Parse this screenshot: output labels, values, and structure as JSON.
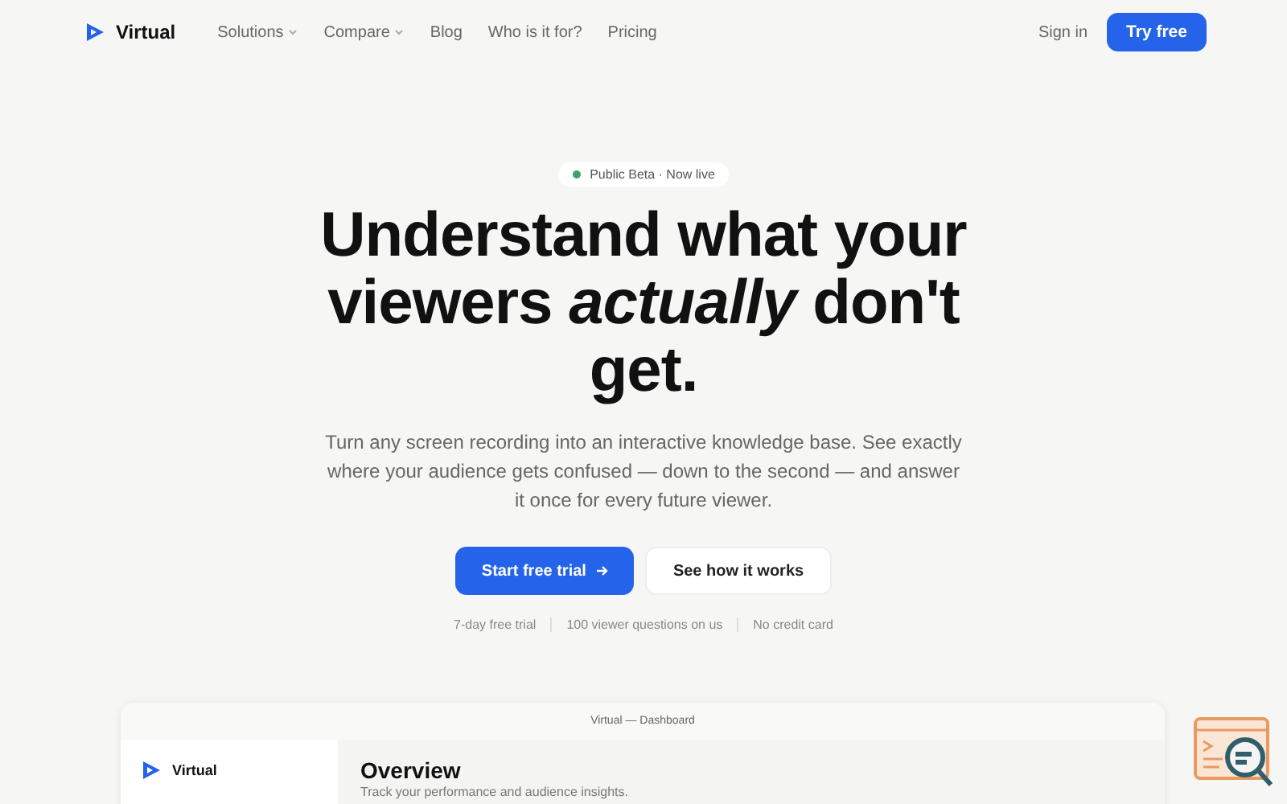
{
  "nav": {
    "brand": "Virtual",
    "links": [
      {
        "label": "Solutions",
        "dropdown": true
      },
      {
        "label": "Compare",
        "dropdown": true
      },
      {
        "label": "Blog",
        "dropdown": false
      },
      {
        "label": "Who is it for?",
        "dropdown": false
      },
      {
        "label": "Pricing",
        "dropdown": false
      }
    ],
    "sign_in": "Sign in",
    "cta": "Try free"
  },
  "hero": {
    "badge": "Public Beta · Now live",
    "headline": "Understand what your viewers *actually* don't get.",
    "subtitle": "Turn any screen recording into an interactive knowledge base. See exactly where your audience gets confused — down to the second — and answer it once for every future viewer.",
    "primary": "Start free trial",
    "secondary": "See how it works",
    "notes": [
      "7-day free trial",
      "100 viewer questions on us",
      "No credit card"
    ]
  },
  "dashboard": {
    "window_title": "Virtual — Dashboard",
    "brand": "Virtual",
    "heading": "Overview",
    "subheading": "Track your performance and audience insights."
  }
}
